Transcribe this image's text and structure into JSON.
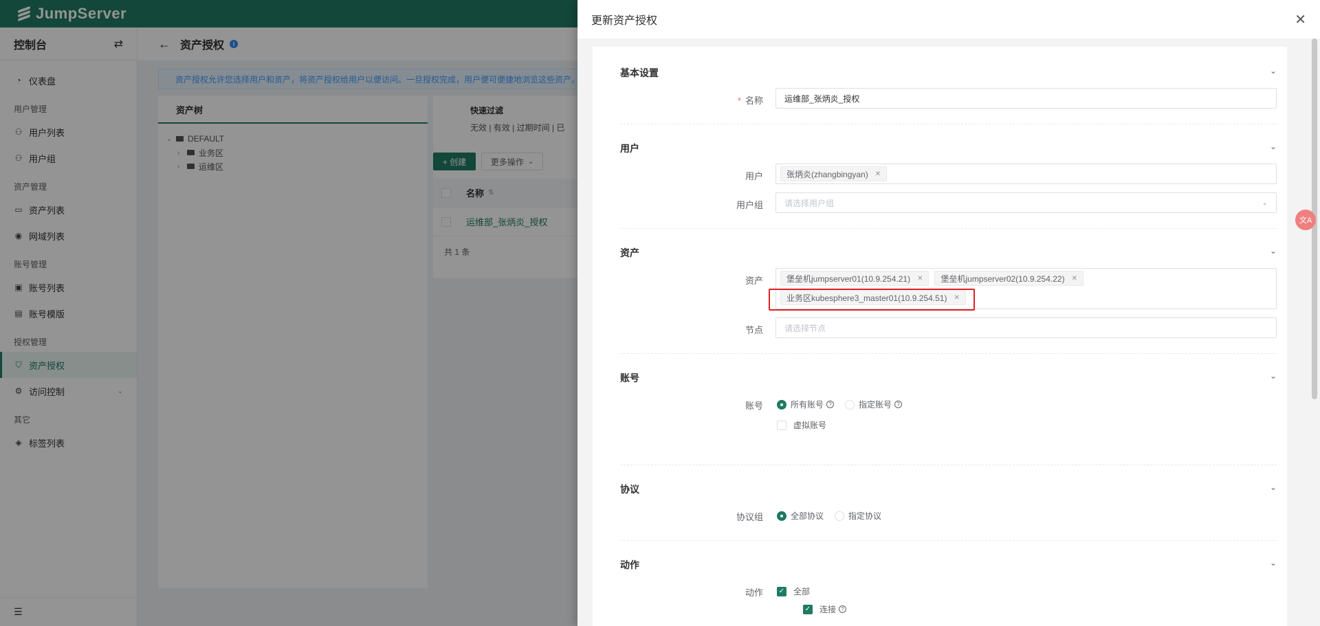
{
  "brand": {
    "name": "JumpServer"
  },
  "sidebar": {
    "title": "控制台",
    "items": [
      {
        "label": "仪表盘"
      },
      {
        "group": "用户管理"
      },
      {
        "label": "用户列表"
      },
      {
        "label": "用户组"
      },
      {
        "group": "资产管理"
      },
      {
        "label": "资产列表"
      },
      {
        "label": "网域列表"
      },
      {
        "group": "账号管理"
      },
      {
        "label": "账号列表"
      },
      {
        "label": "账号模版"
      },
      {
        "group": "授权管理"
      },
      {
        "label": "资产授权"
      },
      {
        "label": "访问控制"
      },
      {
        "group": "其它"
      },
      {
        "label": "标签列表"
      }
    ]
  },
  "page": {
    "title": "资产授权",
    "banner": "资产授权允许您选择用户和资产，将资产授权给用户以便访问。一旦授权完成，用户便可便捷地浏览这些资产。",
    "tree_title": "资产树",
    "tree": [
      "DEFAULT",
      "业务区",
      "运维区"
    ],
    "quick_filter": "快速过滤",
    "filters": "无效 | 有效 | 过期时间 | 已",
    "create": "+ 创建",
    "more": "更多操作",
    "col_name": "名称",
    "row_name": "运维部_张炳炎_授权",
    "total": "共 1 条"
  },
  "drawer": {
    "title": "更新资产授权",
    "sections": {
      "basic": "基本设置",
      "user": "用户",
      "asset": "资产",
      "account": "账号",
      "protocol": "协议",
      "action": "动作"
    },
    "labels": {
      "name": "名称",
      "user": "用户",
      "user_group": "用户组",
      "asset": "资产",
      "node": "节点",
      "account": "账号",
      "protocol_group": "协议组",
      "action": "动作"
    },
    "values": {
      "name": "运维部_张炳炎_授权",
      "user_tag": "张炳炎(zhangbingyan)",
      "user_group_placeholder": "请选择用户组",
      "asset_tag_1": "堡垒机jumpserver01(10.9.254.21)",
      "asset_tag_2": "堡垒机jumpserver02(10.9.254.22)",
      "asset_tag_3": "业务区kubesphere3_master01(10.9.254.51)",
      "node_placeholder": "请选择节点",
      "all_accounts": "所有账号",
      "specified_accounts": "指定账号",
      "virtual_accounts": "虚拟账号",
      "all_protocols": "全部协议",
      "specified_protocols": "指定协议",
      "action_all": "全部",
      "action_connect": "连接"
    }
  }
}
